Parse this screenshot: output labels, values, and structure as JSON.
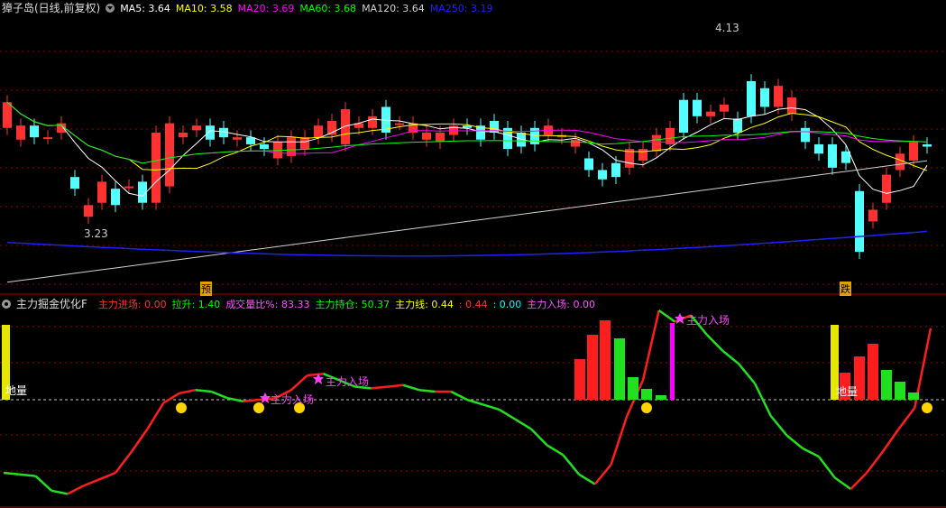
{
  "colors": {
    "up": "#ff3232",
    "down": "#54ffff",
    "grid": "#8b0000",
    "ma5": "#ffffff",
    "ma10": "#ffff00",
    "ma20": "#ff00ff",
    "ma60": "#00ff00",
    "ma120": "#d0d0d0",
    "ma250": "#2020ff"
  },
  "top": {
    "title": "獐子岛(日线,前复权)",
    "ma": [
      {
        "name": "MA5",
        "value": "3.64",
        "color": "#ffffff"
      },
      {
        "name": "MA10",
        "value": "3.58",
        "color": "#ffff00"
      },
      {
        "name": "MA20",
        "value": "3.69",
        "color": "#ff00ff"
      },
      {
        "name": "MA60",
        "value": "3.68",
        "color": "#00ff00"
      },
      {
        "name": "MA120",
        "value": "3.64",
        "color": "#d0d0d0"
      },
      {
        "name": "MA250",
        "value": "3.19",
        "color": "#2020ff"
      }
    ],
    "high_label": "4.13",
    "low_label": "3.23",
    "tag_left": "预",
    "tag_right": "跌"
  },
  "bottom": {
    "title": "主力掘金优化F",
    "indicators": [
      {
        "name": "主力进场",
        "value": "0.00",
        "color": "#ff3232"
      },
      {
        "name": "拉升",
        "value": "1.40",
        "color": "#00ff00"
      },
      {
        "name": "成交量比%",
        "value": "83.33",
        "color": "#ff55ff"
      },
      {
        "name": "主力持仓",
        "value": "50.37",
        "color": "#00ff00"
      },
      {
        "name": "主力线",
        "value": "0.44",
        "color": "#ffff00"
      },
      {
        "name": "",
        "value": "0.44",
        "color": "#ff3232"
      },
      {
        "name": "",
        "value": "0.00",
        "color": "#00ffff"
      },
      {
        "name": "主力入场",
        "value": "0.00",
        "color": "#ff55ff"
      }
    ],
    "entry_label": "主力入场",
    "floor_label": "地量"
  },
  "chart_data": [
    {
      "type": "candlestick",
      "title": "獐子岛(日线,前复权)",
      "ylim": [
        3.1,
        4.25
      ],
      "x": [
        1,
        2,
        3,
        4,
        5,
        6,
        7,
        8,
        9,
        10,
        11,
        12,
        13,
        14,
        15,
        16,
        17,
        18,
        19,
        20,
        21,
        22,
        23,
        24,
        25,
        26,
        27,
        28,
        29,
        30,
        31,
        32,
        33,
        34,
        35,
        36,
        37,
        38,
        39,
        40,
        41,
        42,
        43,
        44,
        45,
        46,
        47,
        48,
        49,
        50,
        51,
        52,
        53,
        54,
        55,
        56,
        57,
        58,
        59,
        60,
        61,
        62,
        63,
        64,
        65,
        66,
        67,
        68,
        69
      ],
      "open": [
        3.78,
        3.73,
        3.79,
        3.74,
        3.76,
        3.57,
        3.4,
        3.46,
        3.52,
        3.53,
        3.55,
        3.46,
        3.53,
        3.74,
        3.77,
        3.79,
        3.78,
        3.73,
        3.74,
        3.71,
        3.65,
        3.66,
        3.69,
        3.74,
        3.75,
        3.71,
        3.78,
        3.78,
        3.87,
        3.8,
        3.76,
        3.73,
        3.72,
        3.75,
        3.79,
        3.79,
        3.81,
        3.78,
        3.76,
        3.78,
        3.75,
        3.74,
        3.7,
        3.65,
        3.6,
        3.63,
        3.61,
        3.64,
        3.68,
        3.71,
        3.9,
        3.9,
        3.83,
        3.85,
        3.82,
        3.98,
        3.95,
        3.87,
        3.84,
        3.78,
        3.71,
        3.71,
        3.68,
        3.51,
        3.38,
        3.46,
        3.6,
        3.64,
        3.71
      ],
      "close": [
        3.89,
        3.79,
        3.74,
        3.74,
        3.8,
        3.52,
        3.45,
        3.55,
        3.45,
        3.53,
        3.46,
        3.76,
        3.8,
        3.76,
        3.79,
        3.73,
        3.74,
        3.74,
        3.71,
        3.69,
        3.72,
        3.74,
        3.74,
        3.79,
        3.81,
        3.86,
        3.8,
        3.83,
        3.76,
        3.8,
        3.8,
        3.76,
        3.76,
        3.79,
        3.78,
        3.73,
        3.76,
        3.69,
        3.7,
        3.71,
        3.79,
        3.75,
        3.73,
        3.6,
        3.56,
        3.57,
        3.69,
        3.69,
        3.75,
        3.78,
        3.76,
        3.83,
        3.85,
        3.88,
        3.76,
        3.83,
        3.87,
        3.96,
        3.91,
        3.72,
        3.67,
        3.61,
        3.63,
        3.25,
        3.43,
        3.58,
        3.67,
        3.72,
        3.7
      ]
    },
    {
      "type": "line",
      "title": "主力掘金优化F",
      "series": [
        {
          "name": "主力进场",
          "values": [
            0.0,
            0.0,
            0.0,
            0.0,
            0.0,
            0.0,
            0.0,
            0.0,
            0.0,
            0.0,
            0.0,
            0.0,
            0.0,
            0.0,
            0.0,
            0.0,
            0.0,
            0.0,
            0.0,
            0.0,
            0.0,
            0.0,
            0.0,
            0.0,
            0.0,
            0.0,
            0.0,
            0.0,
            0.0,
            0.0,
            0.0,
            0.0,
            0.0,
            0.0,
            0.0,
            0.0,
            0.0,
            0.0,
            0.0,
            0.0,
            0.0,
            0.0,
            0.0,
            0.0,
            0.0,
            0.0,
            0.0,
            0.0,
            0.0,
            0.0,
            0.0,
            0.0,
            0.0,
            0.0,
            0.0,
            0.0,
            0.0,
            0.0,
            0.0,
            0.0,
            0.0,
            0.0,
            0.0,
            0.0,
            0.0,
            0.0,
            0.0,
            0.0,
            0.0
          ]
        },
        {
          "name": "主力线",
          "values": [
            -0.45,
            -0.46,
            -0.47,
            -0.56,
            -0.58,
            -0.53,
            -0.49,
            -0.45,
            -0.32,
            -0.18,
            -0.02,
            0.04,
            0.06,
            0.05,
            0.01,
            -0.01,
            0.0,
            0.01,
            0.06,
            0.15,
            0.16,
            0.12,
            0.08,
            0.07,
            0.08,
            0.09,
            0.06,
            0.05,
            0.05,
            0.0,
            -0.03,
            -0.06,
            -0.12,
            -0.18,
            -0.28,
            -0.34,
            -0.46,
            -0.52,
            -0.4,
            -0.1,
            0.12,
            0.55,
            0.48,
            0.52,
            0.4,
            0.3,
            0.22,
            0.1,
            -0.1,
            -0.22,
            -0.3,
            -0.35,
            -0.48,
            -0.55,
            -0.45,
            -0.32,
            -0.18,
            -0.05,
            0.44
          ]
        }
      ]
    }
  ]
}
